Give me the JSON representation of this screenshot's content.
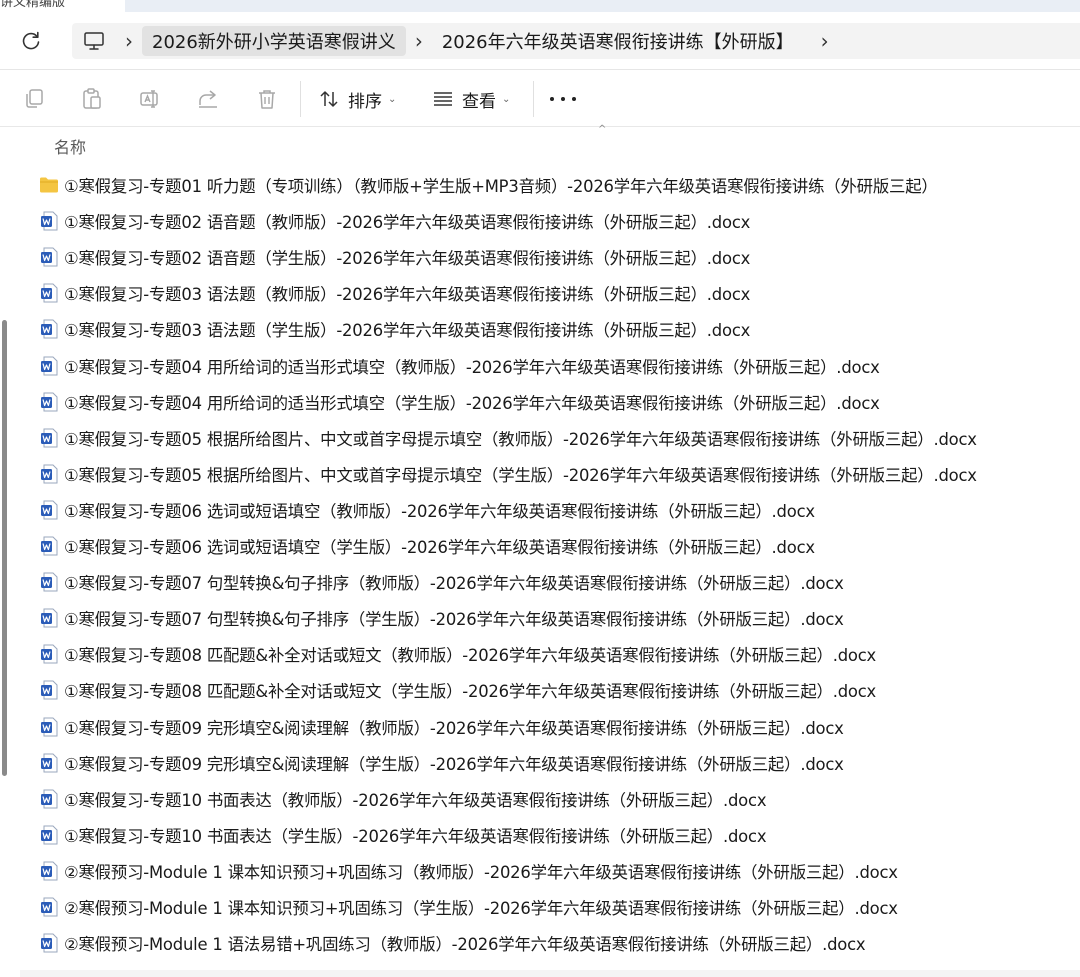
{
  "window": {
    "partial_tab_title": "讲义精编版"
  },
  "address": {
    "breadcrumbs": [
      "2026新外研小学英语寒假讲义",
      "2026年六年级英语寒假衔接讲练【外研版】"
    ],
    "separator": "›"
  },
  "toolbar": {
    "sort_label": "排序",
    "view_label": "查看",
    "icons": [
      "copy-icon",
      "paste-icon",
      "rename-icon",
      "share-icon",
      "delete-icon"
    ]
  },
  "list": {
    "column_name": "名称",
    "files": [
      {
        "name": "①寒假复习-专题01 听力题（专项训练）（教师版+学生版+MP3音频）-2026学年六年级英语寒假衔接讲练（外研版三起）",
        "type": "folder"
      },
      {
        "name": "①寒假复习-专题02 语音题（教师版）-2026学年六年级英语寒假衔接讲练（外研版三起）.docx",
        "type": "docx"
      },
      {
        "name": "①寒假复习-专题02 语音题（学生版）-2026学年六年级英语寒假衔接讲练（外研版三起）.docx",
        "type": "docx"
      },
      {
        "name": "①寒假复习-专题03 语法题（教师版）-2026学年六年级英语寒假衔接讲练（外研版三起）.docx",
        "type": "docx"
      },
      {
        "name": "①寒假复习-专题03 语法题（学生版）-2026学年六年级英语寒假衔接讲练（外研版三起）.docx",
        "type": "docx"
      },
      {
        "name": "①寒假复习-专题04 用所给词的适当形式填空（教师版）-2026学年六年级英语寒假衔接讲练（外研版三起）.docx",
        "type": "docx"
      },
      {
        "name": "①寒假复习-专题04 用所给词的适当形式填空（学生版）-2026学年六年级英语寒假衔接讲练（外研版三起）.docx",
        "type": "docx"
      },
      {
        "name": "①寒假复习-专题05 根据所给图片、中文或首字母提示填空（教师版）-2026学年六年级英语寒假衔接讲练（外研版三起）.docx",
        "type": "docx"
      },
      {
        "name": "①寒假复习-专题05 根据所给图片、中文或首字母提示填空（学生版）-2026学年六年级英语寒假衔接讲练（外研版三起）.docx",
        "type": "docx"
      },
      {
        "name": "①寒假复习-专题06 选词或短语填空（教师版）-2026学年六年级英语寒假衔接讲练（外研版三起）.docx",
        "type": "docx"
      },
      {
        "name": "①寒假复习-专题06 选词或短语填空（学生版）-2026学年六年级英语寒假衔接讲练（外研版三起）.docx",
        "type": "docx"
      },
      {
        "name": "①寒假复习-专题07 句型转换&句子排序（教师版）-2026学年六年级英语寒假衔接讲练（外研版三起）.docx",
        "type": "docx"
      },
      {
        "name": "①寒假复习-专题07 句型转换&句子排序（学生版）-2026学年六年级英语寒假衔接讲练（外研版三起）.docx",
        "type": "docx"
      },
      {
        "name": "①寒假复习-专题08 匹配题&补全对话或短文（教师版）-2026学年六年级英语寒假衔接讲练（外研版三起）.docx",
        "type": "docx"
      },
      {
        "name": "①寒假复习-专题08 匹配题&补全对话或短文（学生版）-2026学年六年级英语寒假衔接讲练（外研版三起）.docx",
        "type": "docx"
      },
      {
        "name": "①寒假复习-专题09 完形填空&阅读理解（教师版）-2026学年六年级英语寒假衔接讲练（外研版三起）.docx",
        "type": "docx"
      },
      {
        "name": "①寒假复习-专题09 完形填空&阅读理解（学生版）-2026学年六年级英语寒假衔接讲练（外研版三起）.docx",
        "type": "docx"
      },
      {
        "name": "①寒假复习-专题10 书面表达（教师版）-2026学年六年级英语寒假衔接讲练（外研版三起）.docx",
        "type": "docx"
      },
      {
        "name": "①寒假复习-专题10 书面表达（学生版）-2026学年六年级英语寒假衔接讲练（外研版三起）.docx",
        "type": "docx"
      },
      {
        "name": "②寒假预习-Module 1 课本知识预习+巩固练习（教师版）-2026学年六年级英语寒假衔接讲练（外研版三起）.docx",
        "type": "docx"
      },
      {
        "name": "②寒假预习-Module 1 课本知识预习+巩固练习（学生版）-2026学年六年级英语寒假衔接讲练（外研版三起）.docx",
        "type": "docx"
      },
      {
        "name": "②寒假预习-Module 1 语法易错+巩固练习（教师版）-2026学年六年级英语寒假衔接讲练（外研版三起）.docx",
        "type": "docx"
      }
    ]
  },
  "colors": {
    "folder": "#f4c542",
    "docx": "#2b5cb8",
    "scrollbar": "#8a8a8a"
  }
}
